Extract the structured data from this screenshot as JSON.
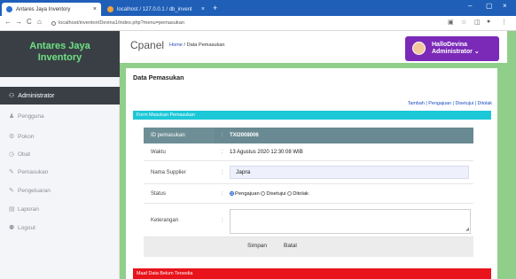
{
  "browser": {
    "tabs": [
      {
        "label": "Antares Jaya Inventory",
        "close": "×"
      },
      {
        "label": "localhost / 127.0.0.1 / db_invent",
        "close": "×"
      }
    ],
    "new_tab": "+",
    "window_controls": [
      "–",
      "▢",
      "×"
    ],
    "nav": {
      "back": "←",
      "forward": "→",
      "reload": "C",
      "home": "⌂"
    },
    "url": "localhost/inventori/Devina1/index.php?menu=pemasukan"
  },
  "sidebar": {
    "brand_line1": "Antares Jaya",
    "brand_line2": "Inventory",
    "admin_label": "Administrator",
    "items": [
      {
        "label": "Pengguna",
        "icon": "♟"
      },
      {
        "label": "Pokon",
        "icon": "⚙"
      },
      {
        "label": "Obat",
        "icon": "◷"
      },
      {
        "label": "Pemasukan",
        "icon": "✎"
      },
      {
        "label": "Pengeluaran",
        "icon": "✎"
      },
      {
        "label": "Laporan",
        "icon": "▤"
      },
      {
        "label": "Logout",
        "icon": "⚉"
      }
    ]
  },
  "header": {
    "title": "Cpanel",
    "breadcrumb_home": "Home",
    "breadcrumb_sep": " / ",
    "breadcrumb_current": "Data Pemasukan",
    "user_greeting": "HalloDevina",
    "user_role": "Administrator",
    "chevron": "⌄"
  },
  "main": {
    "title": "Data Pemasukan",
    "action_links": "Tambah | Pengajuan | Disetujui | Ditolak",
    "form_header": "Form Masukan Pemasukan",
    "fields": {
      "id_label": "ID pemasukan",
      "id_value": "TXI2008006",
      "waktu_label": "Waktu",
      "waktu_value": "13 Agustus 2020 12:30:08 WIB",
      "supplier_label": "Nama Supplier",
      "supplier_value": "Japra",
      "status_label": "Status",
      "status_options": [
        "Pengajuan",
        "Disetujui",
        "Ditolak"
      ],
      "status_selected": "Pengajuan",
      "keterangan_label": "Keterangan",
      "colon": ":"
    },
    "buttons": {
      "save": "Simpan",
      "cancel": "Batal"
    },
    "error_message": "Maaf Data Belum Tersedia"
  },
  "colors": {
    "accent_cyan": "#1cc8d8",
    "user_purple": "#7b2ab8",
    "error_red": "#e8131b",
    "brand_green": "#77d68a"
  }
}
